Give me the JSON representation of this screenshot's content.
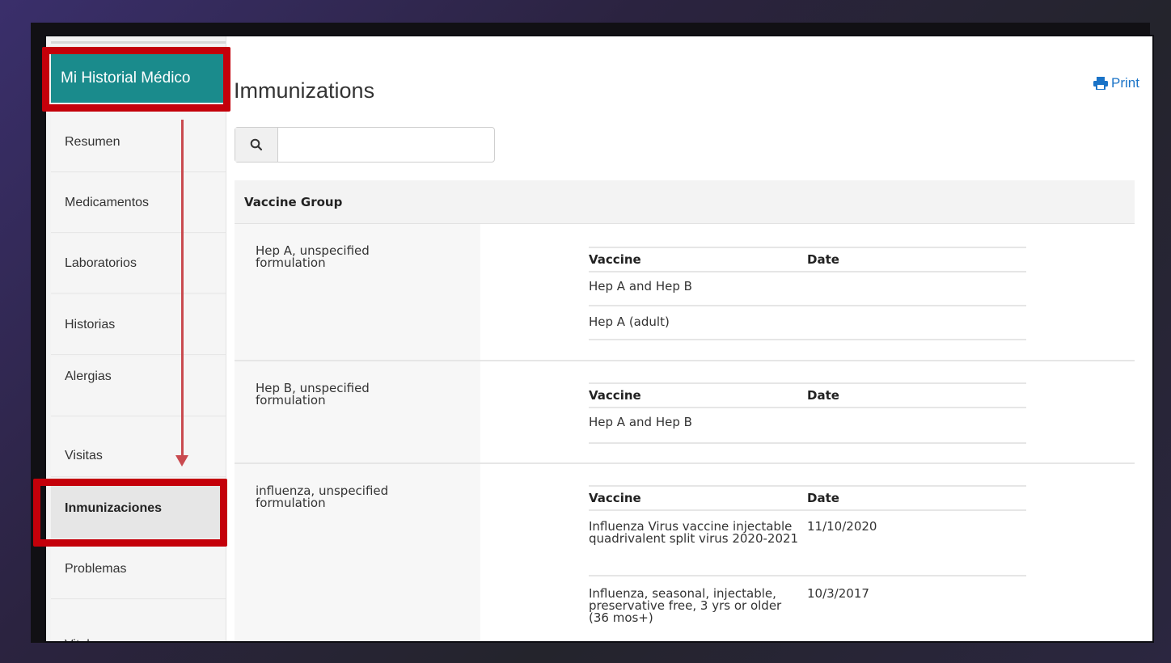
{
  "sidebar": {
    "header": "Mi Historial Médico",
    "items": [
      {
        "label": "Resumen"
      },
      {
        "label": "Medicamentos"
      },
      {
        "label": "Laboratorios"
      },
      {
        "label": "Historias"
      },
      {
        "label": "Alergias"
      },
      {
        "label": "Visitas"
      },
      {
        "label": "Inmunizaciones"
      },
      {
        "label": "Problemas"
      },
      {
        "label": "Vitales"
      }
    ],
    "active": "Inmunizaciones"
  },
  "main": {
    "title": "Immunizations",
    "print_label": "Print",
    "search": {
      "value": "",
      "placeholder": ""
    },
    "group_header": "Vaccine Group",
    "table_headers": {
      "vaccine": "Vaccine",
      "date": "Date"
    },
    "groups": [
      {
        "name": "Hep A, unspecified formulation",
        "vaccines": [
          {
            "vaccine": "Hep A and Hep B",
            "date": ""
          },
          {
            "vaccine": "Hep A (adult)",
            "date": ""
          }
        ]
      },
      {
        "name": "Hep B, unspecified formulation",
        "vaccines": [
          {
            "vaccine": "Hep A and Hep B",
            "date": ""
          }
        ]
      },
      {
        "name": "influenza, unspecified formulation",
        "vaccines": [
          {
            "vaccine": "Influenza Virus vaccine injectable quadrivalent split virus 2020-2021",
            "date": "11/10/2020"
          },
          {
            "vaccine": "Influenza, seasonal, injectable, preservative free, 3 yrs or older (36 mos+)",
            "date": "10/3/2017"
          }
        ]
      }
    ]
  },
  "colors": {
    "sidebar_header": "#1a8b8c",
    "highlight": "#c4000a",
    "arrow": "#c94a4f",
    "print_link": "#1a73c7"
  }
}
